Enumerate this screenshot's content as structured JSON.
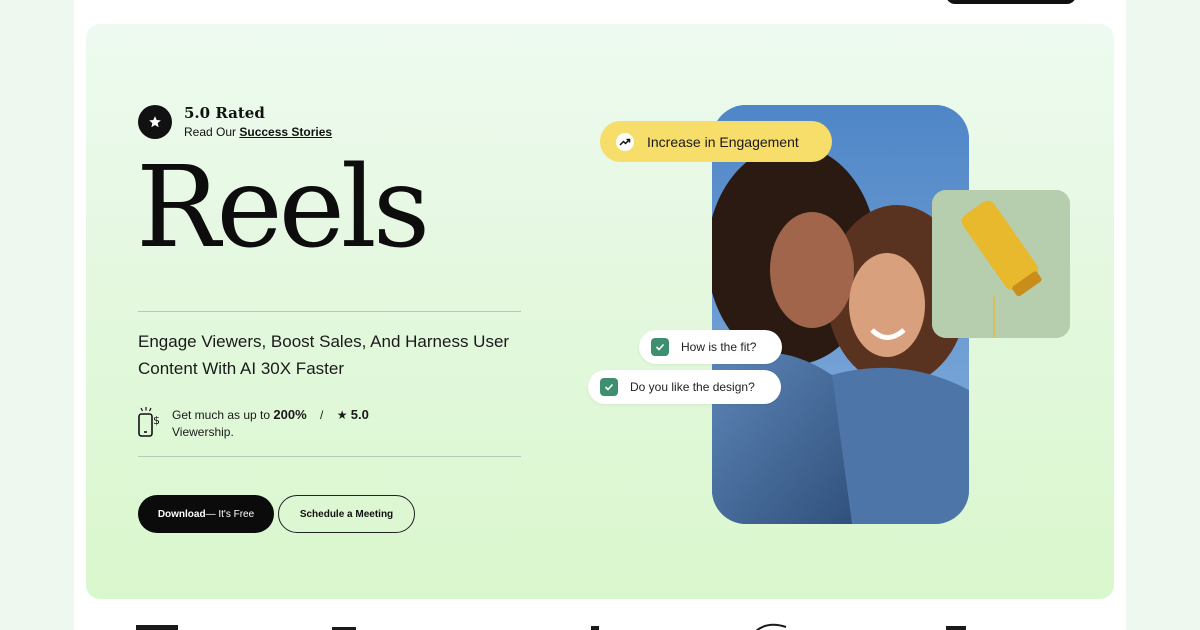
{
  "rating": {
    "title": "5.0 Rated",
    "sub_prefix": "Read Our ",
    "sub_link": "Success Stories"
  },
  "hero": {
    "title": "Reels",
    "tagline": "Engage Viewers, Boost Sales, And Harness User Content With AI 30X Faster"
  },
  "stat": {
    "prefix": "Get much as up to",
    "value": "200%",
    "separator": "/",
    "rating": "5.0",
    "suffix": "Viewership."
  },
  "buttons": {
    "download_strong": "Download",
    "download_rest": " — It's Free",
    "schedule": "Schedule a Meeting"
  },
  "visual": {
    "engagement_label": "Increase in Engagement",
    "question_1": "How is the fit?",
    "question_2": "Do you like the design?"
  },
  "colors": {
    "hero_bg": "#e4f8df",
    "engagement_pill": "#f7dd6a",
    "check_green": "#3d8f6f",
    "primary_button": "#0b0b0b"
  },
  "icons": [
    "star-icon",
    "phone-dollar-icon",
    "trending-up-icon",
    "checkbox-icon"
  ]
}
